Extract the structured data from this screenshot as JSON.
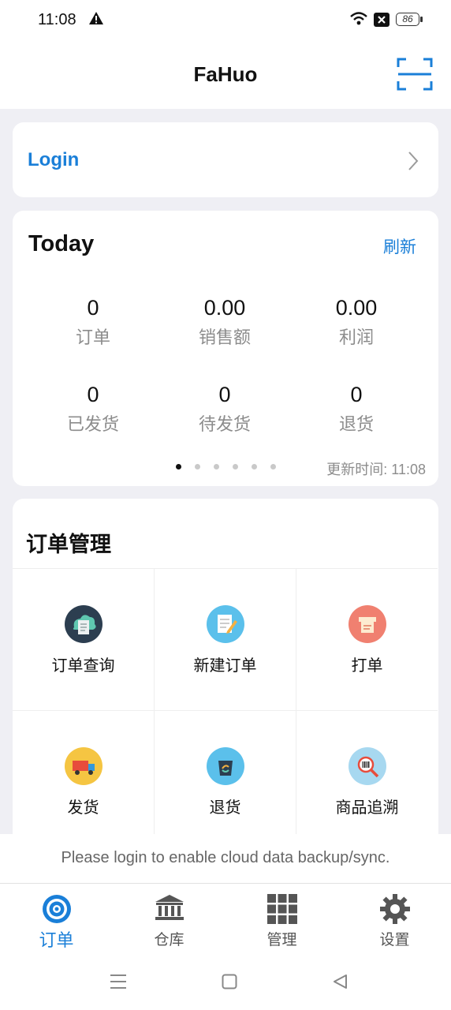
{
  "status_bar": {
    "time": "11:08",
    "battery": "86"
  },
  "app_bar": {
    "title": "FaHuo"
  },
  "login": {
    "label": "Login"
  },
  "today": {
    "title": "Today",
    "refresh_label": "刷新",
    "stats": [
      {
        "value": "0",
        "label": "订单"
      },
      {
        "value": "0.00",
        "label": "销售额"
      },
      {
        "value": "0.00",
        "label": "利润"
      },
      {
        "value": "0",
        "label": "已发货"
      },
      {
        "value": "0",
        "label": "待发货"
      },
      {
        "value": "0",
        "label": "退货"
      }
    ],
    "updated": "更新时间: 11:08",
    "page_dots": 6,
    "active_dot": 0
  },
  "orders": {
    "title": "订单管理",
    "items": [
      {
        "label": "订单查询",
        "icon": "cloud-doc-icon",
        "color": "#2c3e50"
      },
      {
        "label": "新建订单",
        "icon": "notepad-pencil-icon",
        "color": "#5bc0eb"
      },
      {
        "label": "打单",
        "icon": "printer-icon",
        "color": "#f08070"
      },
      {
        "label": "发货",
        "icon": "truck-icon",
        "color": "#f5c542"
      },
      {
        "label": "退货",
        "icon": "bag-return-icon",
        "color": "#5bc0eb"
      },
      {
        "label": "商品追溯",
        "icon": "magnify-barcode-icon",
        "color": "#a7d8f0"
      }
    ]
  },
  "login_note": "Please login to enable cloud data backup/sync.",
  "tabs": [
    {
      "label": "订单",
      "icon": "target-icon",
      "active": true
    },
    {
      "label": "仓库",
      "icon": "bank-icon",
      "active": false
    },
    {
      "label": "管理",
      "icon": "grid-icon",
      "active": false
    },
    {
      "label": "设置",
      "icon": "gear-icon",
      "active": false
    }
  ],
  "colors": {
    "accent": "#1a7fd8",
    "background": "#efeff4"
  }
}
